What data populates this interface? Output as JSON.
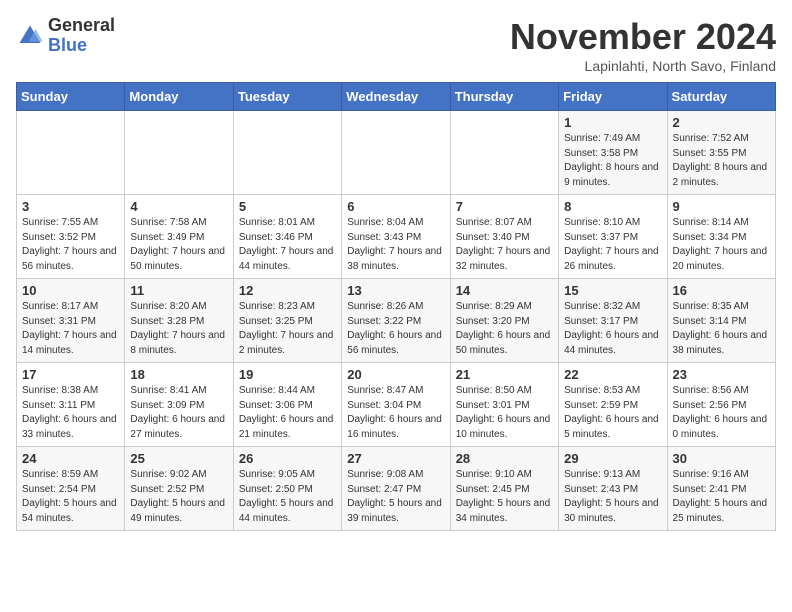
{
  "logo": {
    "text_general": "General",
    "text_blue": "Blue"
  },
  "title": "November 2024",
  "subtitle": "Lapinlahti, North Savo, Finland",
  "days_of_week": [
    "Sunday",
    "Monday",
    "Tuesday",
    "Wednesday",
    "Thursday",
    "Friday",
    "Saturday"
  ],
  "weeks": [
    [
      {
        "day": "",
        "info": ""
      },
      {
        "day": "",
        "info": ""
      },
      {
        "day": "",
        "info": ""
      },
      {
        "day": "",
        "info": ""
      },
      {
        "day": "",
        "info": ""
      },
      {
        "day": "1",
        "info": "Sunrise: 7:49 AM\nSunset: 3:58 PM\nDaylight: 8 hours and 9 minutes."
      },
      {
        "day": "2",
        "info": "Sunrise: 7:52 AM\nSunset: 3:55 PM\nDaylight: 8 hours and 2 minutes."
      }
    ],
    [
      {
        "day": "3",
        "info": "Sunrise: 7:55 AM\nSunset: 3:52 PM\nDaylight: 7 hours and 56 minutes."
      },
      {
        "day": "4",
        "info": "Sunrise: 7:58 AM\nSunset: 3:49 PM\nDaylight: 7 hours and 50 minutes."
      },
      {
        "day": "5",
        "info": "Sunrise: 8:01 AM\nSunset: 3:46 PM\nDaylight: 7 hours and 44 minutes."
      },
      {
        "day": "6",
        "info": "Sunrise: 8:04 AM\nSunset: 3:43 PM\nDaylight: 7 hours and 38 minutes."
      },
      {
        "day": "7",
        "info": "Sunrise: 8:07 AM\nSunset: 3:40 PM\nDaylight: 7 hours and 32 minutes."
      },
      {
        "day": "8",
        "info": "Sunrise: 8:10 AM\nSunset: 3:37 PM\nDaylight: 7 hours and 26 minutes."
      },
      {
        "day": "9",
        "info": "Sunrise: 8:14 AM\nSunset: 3:34 PM\nDaylight: 7 hours and 20 minutes."
      }
    ],
    [
      {
        "day": "10",
        "info": "Sunrise: 8:17 AM\nSunset: 3:31 PM\nDaylight: 7 hours and 14 minutes."
      },
      {
        "day": "11",
        "info": "Sunrise: 8:20 AM\nSunset: 3:28 PM\nDaylight: 7 hours and 8 minutes."
      },
      {
        "day": "12",
        "info": "Sunrise: 8:23 AM\nSunset: 3:25 PM\nDaylight: 7 hours and 2 minutes."
      },
      {
        "day": "13",
        "info": "Sunrise: 8:26 AM\nSunset: 3:22 PM\nDaylight: 6 hours and 56 minutes."
      },
      {
        "day": "14",
        "info": "Sunrise: 8:29 AM\nSunset: 3:20 PM\nDaylight: 6 hours and 50 minutes."
      },
      {
        "day": "15",
        "info": "Sunrise: 8:32 AM\nSunset: 3:17 PM\nDaylight: 6 hours and 44 minutes."
      },
      {
        "day": "16",
        "info": "Sunrise: 8:35 AM\nSunset: 3:14 PM\nDaylight: 6 hours and 38 minutes."
      }
    ],
    [
      {
        "day": "17",
        "info": "Sunrise: 8:38 AM\nSunset: 3:11 PM\nDaylight: 6 hours and 33 minutes."
      },
      {
        "day": "18",
        "info": "Sunrise: 8:41 AM\nSunset: 3:09 PM\nDaylight: 6 hours and 27 minutes."
      },
      {
        "day": "19",
        "info": "Sunrise: 8:44 AM\nSunset: 3:06 PM\nDaylight: 6 hours and 21 minutes."
      },
      {
        "day": "20",
        "info": "Sunrise: 8:47 AM\nSunset: 3:04 PM\nDaylight: 6 hours and 16 minutes."
      },
      {
        "day": "21",
        "info": "Sunrise: 8:50 AM\nSunset: 3:01 PM\nDaylight: 6 hours and 10 minutes."
      },
      {
        "day": "22",
        "info": "Sunrise: 8:53 AM\nSunset: 2:59 PM\nDaylight: 6 hours and 5 minutes."
      },
      {
        "day": "23",
        "info": "Sunrise: 8:56 AM\nSunset: 2:56 PM\nDaylight: 6 hours and 0 minutes."
      }
    ],
    [
      {
        "day": "24",
        "info": "Sunrise: 8:59 AM\nSunset: 2:54 PM\nDaylight: 5 hours and 54 minutes."
      },
      {
        "day": "25",
        "info": "Sunrise: 9:02 AM\nSunset: 2:52 PM\nDaylight: 5 hours and 49 minutes."
      },
      {
        "day": "26",
        "info": "Sunrise: 9:05 AM\nSunset: 2:50 PM\nDaylight: 5 hours and 44 minutes."
      },
      {
        "day": "27",
        "info": "Sunrise: 9:08 AM\nSunset: 2:47 PM\nDaylight: 5 hours and 39 minutes."
      },
      {
        "day": "28",
        "info": "Sunrise: 9:10 AM\nSunset: 2:45 PM\nDaylight: 5 hours and 34 minutes."
      },
      {
        "day": "29",
        "info": "Sunrise: 9:13 AM\nSunset: 2:43 PM\nDaylight: 5 hours and 30 minutes."
      },
      {
        "day": "30",
        "info": "Sunrise: 9:16 AM\nSunset: 2:41 PM\nDaylight: 5 hours and 25 minutes."
      }
    ]
  ]
}
